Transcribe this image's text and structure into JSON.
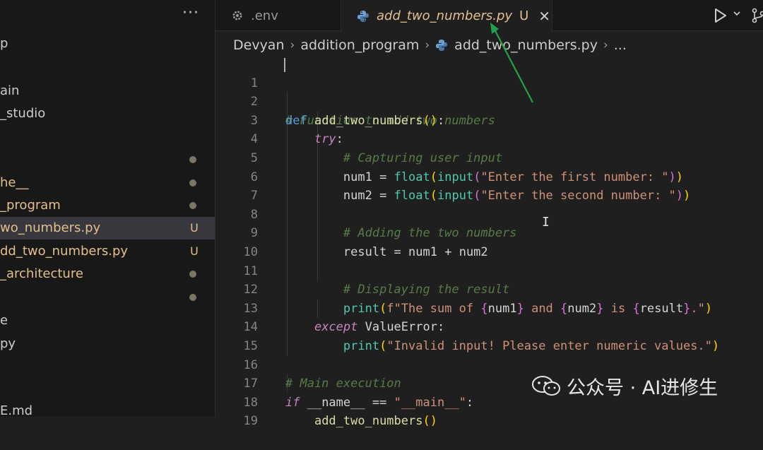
{
  "sidebar": {
    "more_label": "···",
    "items": [
      {
        "label": "p",
        "color": "#cccccc",
        "status": ""
      },
      {
        "label": "ain",
        "color": "#cccccc",
        "status": ""
      },
      {
        "label": "_studio",
        "color": "#cccccc",
        "status": ""
      },
      {
        "label": "",
        "color": "#cccccc",
        "status": "dot"
      },
      {
        "label": "he__",
        "color": "#e2c08d",
        "status": "dot"
      },
      {
        "label": "_program",
        "color": "#e2c08d",
        "status": "dot"
      },
      {
        "label": "wo_numbers.py",
        "color": "#e2c08d",
        "status": "U"
      },
      {
        "label": "dd_two_numbers.py",
        "color": "#e2c08d",
        "status": "U"
      },
      {
        "label": "_architecture",
        "color": "#e2c08d",
        "status": "dot"
      },
      {
        "label": "",
        "color": "#cccccc",
        "status": "dot"
      },
      {
        "label": "e",
        "color": "#cccccc",
        "status": ""
      },
      {
        "label": "py",
        "color": "#cccccc",
        "status": ""
      },
      {
        "label": "E.md",
        "color": "#cccccc",
        "status": ""
      }
    ]
  },
  "tabs": [
    {
      "label": ".env",
      "icon": "gear-icon"
    },
    {
      "label": "add_two_numbers.py",
      "icon": "python-icon",
      "status": "U",
      "close": "✕"
    }
  ],
  "breadcrumb": {
    "parts": [
      "Devyan",
      "addition_program",
      "add_two_numbers.py",
      "..."
    ],
    "separator": "›"
  },
  "editor": {
    "line_numbers": [
      "1",
      "2",
      "3",
      "4",
      "5",
      "6",
      "7",
      "8",
      "9",
      "10",
      "11",
      "12",
      "13",
      "14",
      "15",
      "16",
      "17",
      "18",
      "19"
    ],
    "code": {
      "l1_comment": "# Function to add two numbers",
      "l2_def": "def",
      "l2_name": "add_two_numbers",
      "l2_open": "(",
      "l2_close": ")",
      "l2_colon": ":",
      "l3_try": "try",
      "l3_colon": ":",
      "l4_comment": "# Capturing user input",
      "l5_var": "num1",
      "l5_eq": " = ",
      "l5_float": "float",
      "l5_p1o": "(",
      "l5_input": "input",
      "l5_p2o": "(",
      "l5_str": "\"Enter the first number: \"",
      "l5_p2c": ")",
      "l5_p1c": ")",
      "l6_var": "num2",
      "l6_eq": " = ",
      "l6_float": "float",
      "l6_p1o": "(",
      "l6_input": "input",
      "l6_p2o": "(",
      "l6_str": "\"Enter the second number: \"",
      "l6_p2c": ")",
      "l6_p1c": ")",
      "l8_comment": "# Adding the two numbers",
      "l9_var": "result",
      "l9_eq": " = ",
      "l9_a": "num1",
      "l9_plus": " + ",
      "l9_b": "num2",
      "l11_comment": "# Displaying the result",
      "l12_print": "print",
      "l12_p1o": "(",
      "l12_s1": "f\"The sum of ",
      "l12_b1o": "{",
      "l12_v1": "num1",
      "l12_b1c": "}",
      "l12_s2": " and ",
      "l12_b2o": "{",
      "l12_v2": "num2",
      "l12_b2c": "}",
      "l12_s3": " is ",
      "l12_b3o": "{",
      "l12_v3": "result",
      "l12_b3c": "}",
      "l12_s4": ".\"",
      "l12_p1c": ")",
      "l13_except": "except",
      "l13_err": " ValueError",
      "l13_colon": ":",
      "l14_print": "print",
      "l14_p1o": "(",
      "l14_str": "\"Invalid input! Please enter numeric values.\"",
      "l14_p1c": ")",
      "l16_comment": "# Main execution",
      "l17_if": "if",
      "l17_name": " __name__ ",
      "l17_eq": "==",
      "l17_str": " \"__main__\"",
      "l17_colon": ":",
      "l18_call": "add_two_numbers",
      "l18_p": "()"
    }
  },
  "watermark": {
    "text": "公众号 · AI进修生"
  },
  "colors": {
    "accent_modified": "#e2c08d",
    "annotation_arrow": "#1fa34a"
  }
}
